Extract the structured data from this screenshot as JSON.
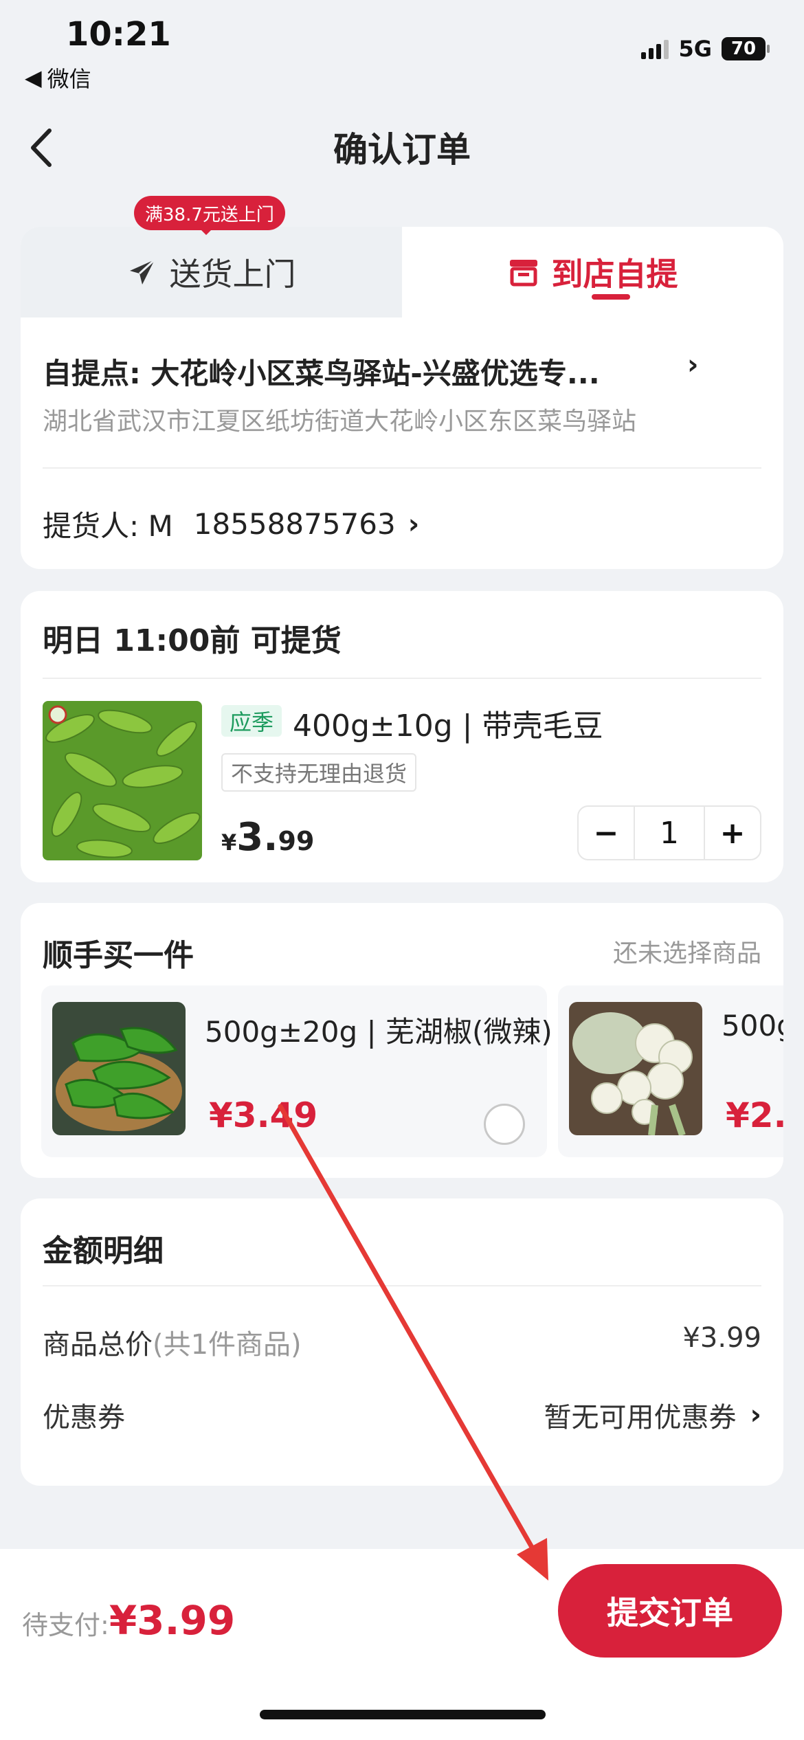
{
  "status_bar": {
    "time": "10:21",
    "back_app": "微信",
    "network": "5G",
    "battery": "70"
  },
  "nav": {
    "title": "确认订单"
  },
  "delivery": {
    "badge": "满38.7元送上门",
    "tabs": [
      {
        "label": "送货上门",
        "active": false
      },
      {
        "label": "到店自提",
        "active": true
      }
    ],
    "pickup_point": "自提点: 大花岭小区菜鸟驿站-兴盛优选专...",
    "pickup_address": "湖北省武汉市江夏区纸坊街道大花岭小区东区菜鸟驿站",
    "picker": {
      "label": "提货人: M",
      "phone": "18558875763"
    }
  },
  "order_item": {
    "pickup_time": "明日 11:00前 可提货",
    "tag": "应季",
    "name": "400g±10g | 带壳毛豆",
    "return_tag": "不支持无理由退货",
    "price_symbol": "¥",
    "price_int": "3.",
    "price_dec": "99",
    "quantity": "1",
    "minus": "−",
    "plus": "+"
  },
  "addon": {
    "title": "顺手买一件",
    "hint": "还未选择商品",
    "items": [
      {
        "name": "500g±20g | 芜湖椒(微辣)",
        "price": "¥3.49"
      },
      {
        "name": "500g",
        "price": "¥2."
      }
    ]
  },
  "amount": {
    "title": "金额明细",
    "rows": [
      {
        "label": "商品总价",
        "sub": "(共1件商品)",
        "value": "¥3.99"
      },
      {
        "label": "优惠券",
        "sub": "",
        "value": "暂无可用优惠券"
      }
    ]
  },
  "footer": {
    "pay_label": "待支付:",
    "pay_amount": "¥3.99",
    "submit": "提交订单"
  },
  "colors": {
    "brand_red": "#d8213b",
    "season_green": "#1d9b5e",
    "background": "#f0f2f5"
  },
  "icons": [
    "back-arrow-icon",
    "paper-plane-icon",
    "store-icon",
    "chevron-right-icon"
  ]
}
